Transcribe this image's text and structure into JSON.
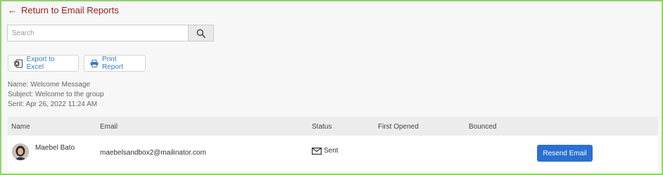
{
  "nav": {
    "back_label": "Return to Email Reports"
  },
  "search": {
    "placeholder": "Search",
    "value": ""
  },
  "toolbar": {
    "export_label": "Export to Excel",
    "print_label": "Print Report"
  },
  "report": {
    "name": "Name: Welcome Message",
    "subject": "Subject: Welcome to the group",
    "sent": "Sent: Apr 26, 2022 11:24 AM"
  },
  "table": {
    "headers": [
      "Name",
      "Email",
      "Status",
      "First Opened",
      "Bounced"
    ],
    "rows": [
      {
        "name": "Maebel Bato",
        "email": "maebelsandbox2@mailinator.com",
        "status": "Sent",
        "first_opened": "",
        "bounced": "",
        "action": "Resend Email"
      }
    ]
  },
  "colors": {
    "frame_border": "#8fd36b",
    "back_link": "#9b1c1c",
    "link_blue": "#3a7bc8",
    "primary_button": "#2a70d2"
  },
  "icons": {
    "back": "arrow-left-icon",
    "search": "magnifier-icon",
    "excel": "excel-icon",
    "print": "printer-icon",
    "status_sent": "envelope-icon"
  }
}
